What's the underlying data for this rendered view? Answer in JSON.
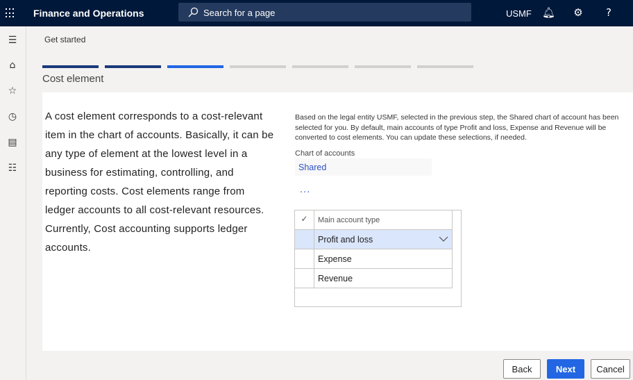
{
  "header": {
    "app_title": "Finance and Operations",
    "search_placeholder": "Search for a page",
    "company": "USMF"
  },
  "breadcrumb": "Get started",
  "wizard": {
    "total_steps": 7,
    "completed_steps": 2,
    "current_step": 3,
    "step_title": "Cost element",
    "colors": {
      "completed": "#1b3a7a",
      "current": "#2266e3",
      "pending": "#d2d0ce"
    }
  },
  "description": "A cost element corresponds to a cost-relevant item in the chart of accounts. Basically, it can be any type of element at the lowest level in a business for estimating, controlling, and reporting costs. Cost elements range from ledger accounts to all cost-relevant resources. Currently, Cost accounting supports ledger accounts.",
  "info": "Based on the legal entity USMF, selected in the previous step, the Shared chart of account has been selected for you. By default, main accounts of type Profit and loss, Expense and Revenue will be converted to cost elements. You can update these selections, if needed.",
  "chart_of_accounts": {
    "label": "Chart of accounts",
    "value": "Shared"
  },
  "more": "...",
  "grid": {
    "header": "Main account type",
    "rows": [
      "Profit and loss",
      "Expense",
      "Revenue"
    ],
    "selected_row": 0
  },
  "buttons": {
    "back": "Back",
    "next": "Next",
    "cancel": "Cancel"
  }
}
